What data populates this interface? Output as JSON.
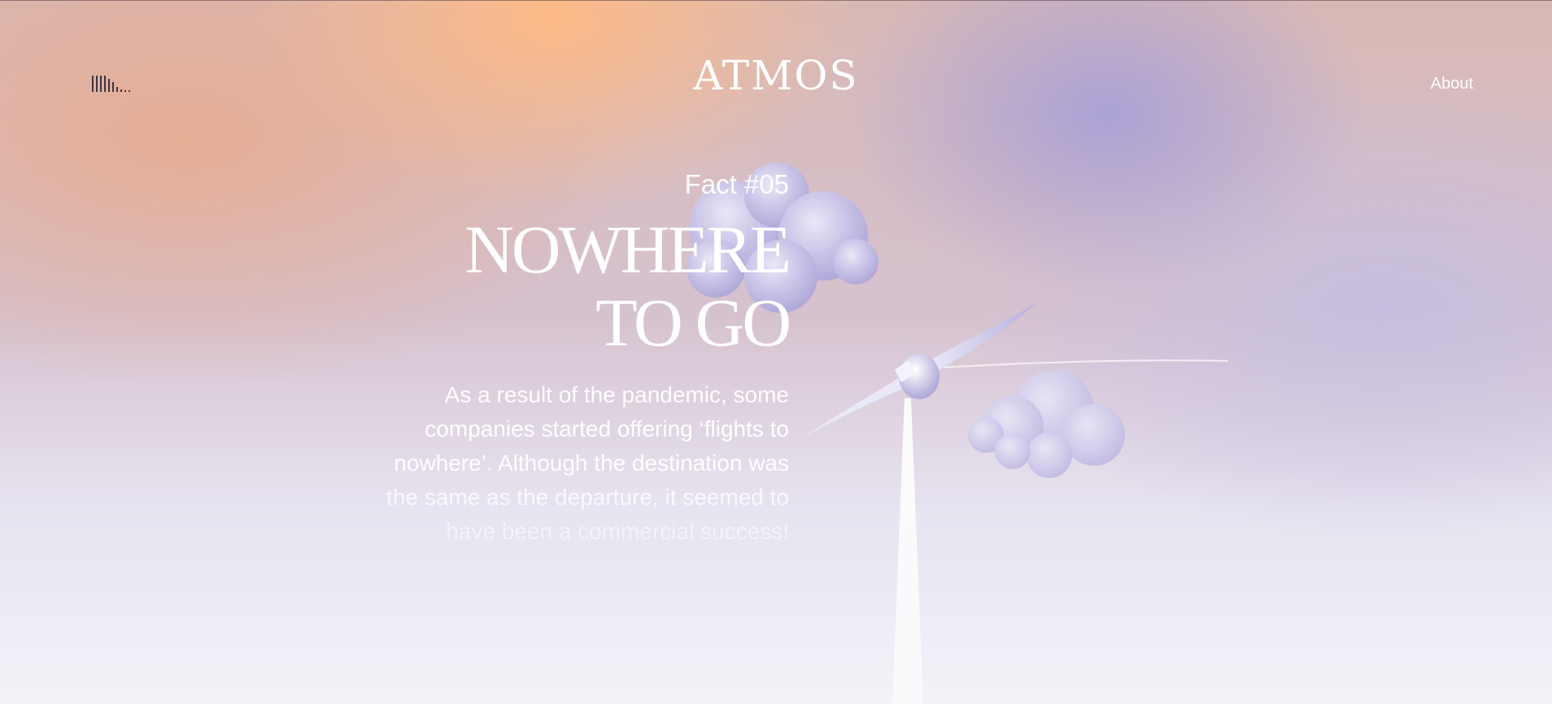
{
  "header": {
    "logo": "ATMOS",
    "nav_about": "About",
    "menu_icon": "audio-bars-icon"
  },
  "fact": {
    "label": "Fact #05",
    "title_lines": [
      "NOWHERE",
      "TO GO"
    ],
    "body": "As a result of the pandemic, some companies started offering ‘flights to nowhere’. Although the destination was the same as the departure, it seemed to have been a commercial success!"
  },
  "colors": {
    "text": "#ffffff",
    "peach": "#ffba84",
    "lavender": "#a8a0d6",
    "menu_bars": "#3c3540"
  },
  "illustration": {
    "objects": [
      "cloud-icon",
      "cloud-icon",
      "airplane-icon",
      "contrail"
    ]
  }
}
